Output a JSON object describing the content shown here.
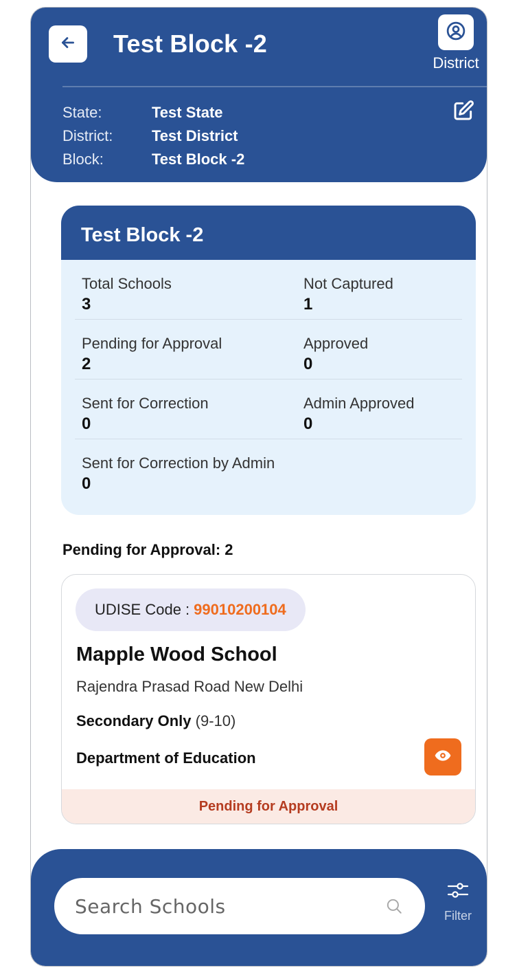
{
  "header": {
    "title": "Test Block -2",
    "profile_label": "District",
    "info": [
      {
        "key": "State:",
        "value": "Test State"
      },
      {
        "key": "District:",
        "value": "Test District"
      },
      {
        "key": "Block:",
        "value": "Test Block -2"
      }
    ]
  },
  "summary": {
    "title": "Test Block -2",
    "stats": [
      {
        "label": "Total Schools",
        "value": "3"
      },
      {
        "label": "Not Captured",
        "value": "1"
      },
      {
        "label": "Pending for Approval",
        "value": "2"
      },
      {
        "label": "Approved",
        "value": "0"
      },
      {
        "label": "Sent for Correction",
        "value": "0"
      },
      {
        "label": "Admin Approved",
        "value": "0"
      },
      {
        "label": "Sent for Correction by Admin",
        "value": "0"
      }
    ]
  },
  "section_title": "Pending for Approval: 2",
  "school": {
    "udise_label": "UDISE Code :",
    "udise_code": "99010200104",
    "name": "Mapple Wood School",
    "address": "Rajendra Prasad Road New Delhi",
    "category": "Secondary Only",
    "grades": "(9-10)",
    "management": "Department of Education",
    "status": "Pending for Approval"
  },
  "bottom": {
    "search_placeholder": "Search Schools",
    "filter_label": "Filter"
  },
  "colors": {
    "primary": "#2a5295",
    "accent": "#ef6c1e",
    "card_bg": "#e6f2fc",
    "status_bg": "#fbeae4",
    "status_text": "#b53c20"
  },
  "icons": {
    "back": "arrow-left-icon",
    "profile": "user-circle-icon",
    "edit": "edit-icon",
    "view": "eye-icon",
    "search": "search-icon",
    "filter": "filter-sliders-icon"
  }
}
